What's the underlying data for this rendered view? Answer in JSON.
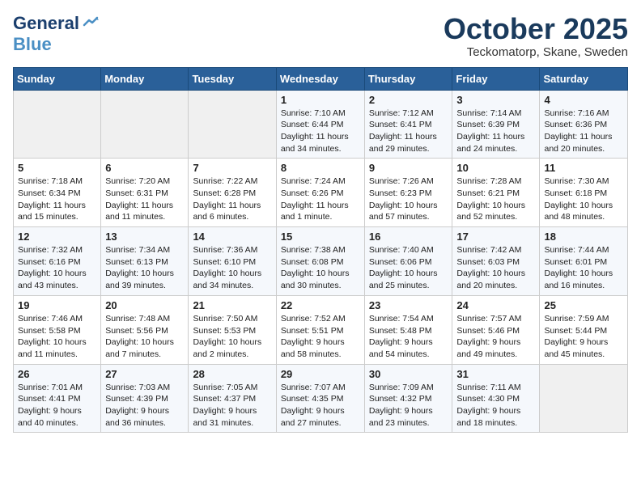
{
  "header": {
    "logo_general": "General",
    "logo_blue": "Blue",
    "month": "October 2025",
    "location": "Teckomatorp, Skane, Sweden"
  },
  "weekdays": [
    "Sunday",
    "Monday",
    "Tuesday",
    "Wednesday",
    "Thursday",
    "Friday",
    "Saturday"
  ],
  "weeks": [
    [
      {
        "day": "",
        "info": ""
      },
      {
        "day": "",
        "info": ""
      },
      {
        "day": "",
        "info": ""
      },
      {
        "day": "1",
        "info": "Sunrise: 7:10 AM\nSunset: 6:44 PM\nDaylight: 11 hours\nand 34 minutes."
      },
      {
        "day": "2",
        "info": "Sunrise: 7:12 AM\nSunset: 6:41 PM\nDaylight: 11 hours\nand 29 minutes."
      },
      {
        "day": "3",
        "info": "Sunrise: 7:14 AM\nSunset: 6:39 PM\nDaylight: 11 hours\nand 24 minutes."
      },
      {
        "day": "4",
        "info": "Sunrise: 7:16 AM\nSunset: 6:36 PM\nDaylight: 11 hours\nand 20 minutes."
      }
    ],
    [
      {
        "day": "5",
        "info": "Sunrise: 7:18 AM\nSunset: 6:34 PM\nDaylight: 11 hours\nand 15 minutes."
      },
      {
        "day": "6",
        "info": "Sunrise: 7:20 AM\nSunset: 6:31 PM\nDaylight: 11 hours\nand 11 minutes."
      },
      {
        "day": "7",
        "info": "Sunrise: 7:22 AM\nSunset: 6:28 PM\nDaylight: 11 hours\nand 6 minutes."
      },
      {
        "day": "8",
        "info": "Sunrise: 7:24 AM\nSunset: 6:26 PM\nDaylight: 11 hours\nand 1 minute."
      },
      {
        "day": "9",
        "info": "Sunrise: 7:26 AM\nSunset: 6:23 PM\nDaylight: 10 hours\nand 57 minutes."
      },
      {
        "day": "10",
        "info": "Sunrise: 7:28 AM\nSunset: 6:21 PM\nDaylight: 10 hours\nand 52 minutes."
      },
      {
        "day": "11",
        "info": "Sunrise: 7:30 AM\nSunset: 6:18 PM\nDaylight: 10 hours\nand 48 minutes."
      }
    ],
    [
      {
        "day": "12",
        "info": "Sunrise: 7:32 AM\nSunset: 6:16 PM\nDaylight: 10 hours\nand 43 minutes."
      },
      {
        "day": "13",
        "info": "Sunrise: 7:34 AM\nSunset: 6:13 PM\nDaylight: 10 hours\nand 39 minutes."
      },
      {
        "day": "14",
        "info": "Sunrise: 7:36 AM\nSunset: 6:10 PM\nDaylight: 10 hours\nand 34 minutes."
      },
      {
        "day": "15",
        "info": "Sunrise: 7:38 AM\nSunset: 6:08 PM\nDaylight: 10 hours\nand 30 minutes."
      },
      {
        "day": "16",
        "info": "Sunrise: 7:40 AM\nSunset: 6:06 PM\nDaylight: 10 hours\nand 25 minutes."
      },
      {
        "day": "17",
        "info": "Sunrise: 7:42 AM\nSunset: 6:03 PM\nDaylight: 10 hours\nand 20 minutes."
      },
      {
        "day": "18",
        "info": "Sunrise: 7:44 AM\nSunset: 6:01 PM\nDaylight: 10 hours\nand 16 minutes."
      }
    ],
    [
      {
        "day": "19",
        "info": "Sunrise: 7:46 AM\nSunset: 5:58 PM\nDaylight: 10 hours\nand 11 minutes."
      },
      {
        "day": "20",
        "info": "Sunrise: 7:48 AM\nSunset: 5:56 PM\nDaylight: 10 hours\nand 7 minutes."
      },
      {
        "day": "21",
        "info": "Sunrise: 7:50 AM\nSunset: 5:53 PM\nDaylight: 10 hours\nand 2 minutes."
      },
      {
        "day": "22",
        "info": "Sunrise: 7:52 AM\nSunset: 5:51 PM\nDaylight: 9 hours\nand 58 minutes."
      },
      {
        "day": "23",
        "info": "Sunrise: 7:54 AM\nSunset: 5:48 PM\nDaylight: 9 hours\nand 54 minutes."
      },
      {
        "day": "24",
        "info": "Sunrise: 7:57 AM\nSunset: 5:46 PM\nDaylight: 9 hours\nand 49 minutes."
      },
      {
        "day": "25",
        "info": "Sunrise: 7:59 AM\nSunset: 5:44 PM\nDaylight: 9 hours\nand 45 minutes."
      }
    ],
    [
      {
        "day": "26",
        "info": "Sunrise: 7:01 AM\nSunset: 4:41 PM\nDaylight: 9 hours\nand 40 minutes."
      },
      {
        "day": "27",
        "info": "Sunrise: 7:03 AM\nSunset: 4:39 PM\nDaylight: 9 hours\nand 36 minutes."
      },
      {
        "day": "28",
        "info": "Sunrise: 7:05 AM\nSunset: 4:37 PM\nDaylight: 9 hours\nand 31 minutes."
      },
      {
        "day": "29",
        "info": "Sunrise: 7:07 AM\nSunset: 4:35 PM\nDaylight: 9 hours\nand 27 minutes."
      },
      {
        "day": "30",
        "info": "Sunrise: 7:09 AM\nSunset: 4:32 PM\nDaylight: 9 hours\nand 23 minutes."
      },
      {
        "day": "31",
        "info": "Sunrise: 7:11 AM\nSunset: 4:30 PM\nDaylight: 9 hours\nand 18 minutes."
      },
      {
        "day": "",
        "info": ""
      }
    ]
  ]
}
